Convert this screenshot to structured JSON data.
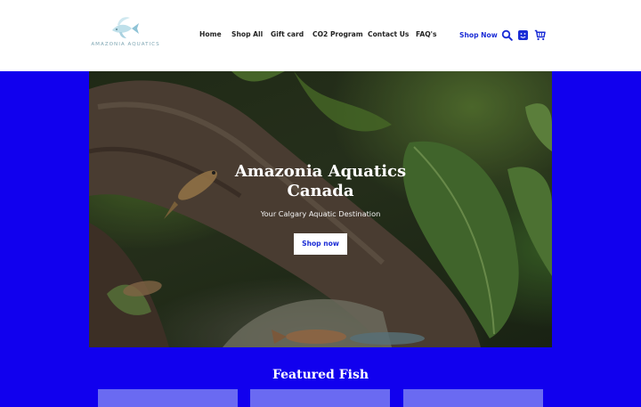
{
  "brand": {
    "name": "AMAZONIA AQUATICS"
  },
  "nav": {
    "items": [
      {
        "label": "Home"
      },
      {
        "label": "Shop All"
      },
      {
        "label": "Gift card"
      },
      {
        "label": "CO2 Program"
      },
      {
        "label": "Contact Us"
      },
      {
        "label": "FAQ's"
      }
    ],
    "shop_now": "Shop Now"
  },
  "header_icons": [
    "search-icon",
    "account-icon",
    "cart-icon"
  ],
  "hero": {
    "title_line1": "Amazonia Aquatics",
    "title_line2": "Canada",
    "subtitle": "Your Calgary Aquatic Destination",
    "button": "Shop now"
  },
  "featured": {
    "title": "Featured Fish"
  },
  "colors": {
    "background": "#1100ee",
    "accent": "#1a2cd6",
    "card": "#6a6af2"
  }
}
